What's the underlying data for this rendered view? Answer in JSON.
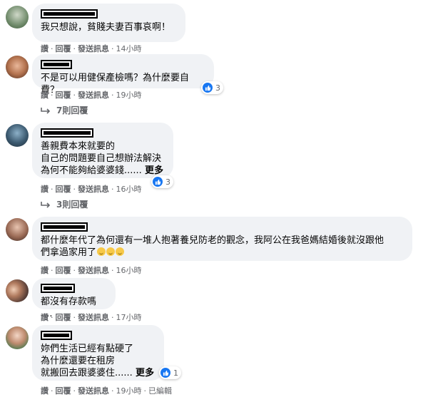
{
  "comments": [
    {
      "text": "我只想說，貧賤夫妻百事哀啊！",
      "time": "14小時",
      "reactions": null
    },
    {
      "text": "不是可以用健保產檢嗎？為什麼要自費？",
      "time": "19小時",
      "reactions": "3",
      "replies": "7則回覆"
    },
    {
      "text": "善親費本來就要的\n自己的問題要自己想辦法解決\n為何不能夠給婆婆錢......",
      "more": "更多",
      "time": "16小時",
      "reactions": "3",
      "replies": "3則回覆"
    },
    {
      "text": "都什麼年代了為何還有一堆人抱著養兒防老的觀念，我阿公在我爸媽結婚後就沒跟他\n們拿過家用了",
      "time": "16小時",
      "reactions": null
    },
    {
      "text": "都沒有存款嗎 ....",
      "time": "17小時",
      "reactions": null
    },
    {
      "text": "妳們生活已經有點硬了\n為什麼還要在租房\n就搬回去跟婆婆住......",
      "more": "更多",
      "time": "19小時",
      "edited": "已編輯",
      "reactions": "1"
    }
  ],
  "actions": {
    "like": "讚",
    "reply": "回覆",
    "send": "發送訊息"
  },
  "colors": {
    "bubble": "#f0f2f5",
    "meta": "#65676b",
    "like": "#1877f2"
  }
}
